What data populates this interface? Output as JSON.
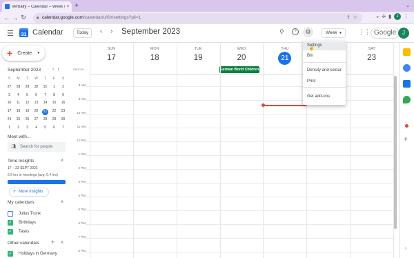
{
  "browser": {
    "tab_title": "Verbally – Calendar – Week of",
    "tab_close": "×",
    "new_tab": "+",
    "url_host": "calendar.google.com",
    "url_path": "/calendar/u/0/r/settings?pli=1",
    "profile_initial": "J"
  },
  "header": {
    "app_title": "Calendar",
    "logo_day": "31",
    "today_label": "Today",
    "period_label": "September 2023",
    "view_label": "Week",
    "brand_label": "Google",
    "user_initial": "J"
  },
  "sidebar": {
    "create_label": "Create",
    "minical": {
      "title": "September 2023",
      "weekday_headers": [
        "S",
        "M",
        "T",
        "W",
        "T",
        "F",
        "S"
      ],
      "weeks": [
        [
          "27",
          "28",
          "29",
          "30",
          "31",
          "1",
          "2"
        ],
        [
          "3",
          "4",
          "5",
          "6",
          "7",
          "8",
          "9"
        ],
        [
          "10",
          "11",
          "12",
          "13",
          "14",
          "15",
          "16"
        ],
        [
          "17",
          "18",
          "19",
          "20",
          "21",
          "22",
          "23"
        ],
        [
          "24",
          "25",
          "26",
          "27",
          "28",
          "29",
          "30"
        ],
        [
          "1",
          "2",
          "3",
          "4",
          "5",
          "6",
          "7"
        ]
      ],
      "selected_day": "21"
    },
    "meet_with_label": "Meet with...",
    "search_people_placeholder": "Search for people",
    "time_insights": {
      "title": "Time Insights",
      "range": "17 – 23 SEPT 2023",
      "hours": "6.9 hrs in meetings (avg: 6.4 hrs)",
      "progress": 1.0,
      "more_label": "More insights"
    },
    "my_calendars": {
      "title": "My calendars",
      "items": [
        {
          "label": "Julius Trunk",
          "checked": false
        },
        {
          "label": "Birthdays",
          "checked": true
        },
        {
          "label": "Tasks",
          "checked": true
        }
      ]
    },
    "other_calendars": {
      "title": "Other calendars",
      "items": [
        {
          "label": "Holidays in Germany",
          "checked": true
        }
      ]
    }
  },
  "week": {
    "timezone": "GMT+02",
    "days": [
      {
        "dow": "SUN",
        "dom": "17"
      },
      {
        "dow": "MON",
        "dom": "18"
      },
      {
        "dow": "TUE",
        "dom": "19"
      },
      {
        "dow": "WED",
        "dom": "20"
      },
      {
        "dow": "THU",
        "dom": "21",
        "today": true
      },
      {
        "dow": "FRI",
        "dom": "22"
      },
      {
        "dow": "SAT",
        "dom": "23"
      }
    ],
    "hours": [
      "8 AM",
      "9 AM",
      "10 AM",
      "11 AM",
      "12 PM",
      "1 PM",
      "2 PM",
      "3 PM",
      "4 PM",
      "5 PM",
      "6 PM",
      "7 PM",
      "8 PM"
    ],
    "allday_event": {
      "title": "German World Children",
      "day": "20"
    }
  },
  "settings_menu": {
    "items": [
      "Settings",
      "Bin",
      "Density and colour",
      "Print",
      "Get add-ons"
    ],
    "highlighted": "Settings"
  },
  "colors": {
    "accent": "#1a73e8",
    "holiday": "#0b8043",
    "now_line": "#ea4335",
    "checked": "#33b679"
  }
}
